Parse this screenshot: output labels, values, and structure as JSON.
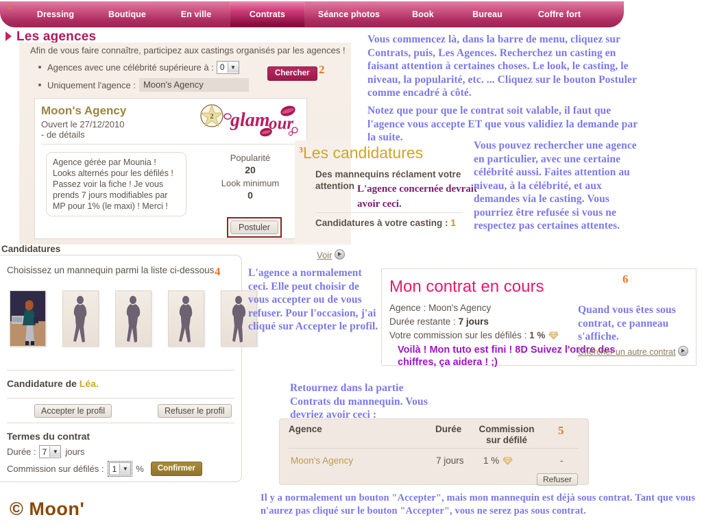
{
  "nav": {
    "marker": "1",
    "items": [
      {
        "label": "Dressing",
        "active": false
      },
      {
        "label": "Boutique",
        "active": false
      },
      {
        "label": "En ville",
        "active": false
      },
      {
        "label": "Contrats",
        "active": true
      },
      {
        "label": "Séance photos",
        "active": false
      },
      {
        "label": "Book",
        "active": false
      },
      {
        "label": "Bureau",
        "active": false
      },
      {
        "label": "Coffre fort",
        "active": false
      }
    ]
  },
  "page": {
    "title": "Les agences",
    "intro": "Afin de vous faire connaître, participez aux castings organisés par les agences !"
  },
  "filters": {
    "celebrity_label": "Agences avec une célébrité supérieure à :",
    "celebrity_value": "0",
    "agency_label": "Uniquement l'agence :",
    "agency_value": "Moon's Agency",
    "search_button": "Chercher",
    "marker": "2"
  },
  "agency_card": {
    "name": "Moon's Agency",
    "opened": "Ouvert le 27/12/2010",
    "details_link": "- de détails",
    "logo_text": "glamour",
    "star_level": "2",
    "description": "Agence gérée par Mounia ! Looks alternés pour les défilés ! Passez voir la fiche ! Je vous prends 7 jours modifiables par MP pour 1% (le maxi) ! Merci !",
    "popularity_label": "Popularité",
    "popularity_value": "20",
    "look_label": "Look minimum",
    "look_value": "0",
    "apply_button": "Postuler"
  },
  "candidatures_box": {
    "marker": "3",
    "title": "Les candidatures",
    "subtitle": "Des mannequins réclament votre attention",
    "count_label": "Candidatures à votre casting :",
    "count_value": "1",
    "see_link": "Voir"
  },
  "candidatures_panel": {
    "header": "Candidatures",
    "choose_text": "Choisissez un mannequin parmi la liste ci-dessous",
    "marker": "4",
    "thumbs": [
      {
        "name": "model-photo-thumb",
        "selected": true
      },
      {
        "name": "model-silhouette-thumb",
        "selected": false
      },
      {
        "name": "model-silhouette-thumb",
        "selected": false
      },
      {
        "name": "model-silhouette-thumb",
        "selected": false
      },
      {
        "name": "model-silhouette-thumb",
        "selected": false
      }
    ],
    "candidate_prefix": "Candidature de",
    "candidate_name": "Léa.",
    "accept_button": "Accepter le profil",
    "refuse_button": "Refuser le profil",
    "terms_title": "Termes du contrat",
    "duration_label": "Durée :",
    "duration_value": "7",
    "duration_unit": "jours",
    "commission_label": "Commission sur défilés :",
    "commission_value": "1",
    "commission_unit": "%",
    "confirm_button": "Confirmer"
  },
  "contract_panel": {
    "marker": "6",
    "title": "Mon contrat en cours",
    "agency_label": "Agence :",
    "agency_value": "Moon's Agency",
    "remaining_label": "Durée restante :",
    "remaining_value": "7 jours",
    "commission_label": "Votre commission sur les défilés :",
    "commission_value": "1 %",
    "tuto_done": "Voilà ! Mon tuto est fini ! 8D Suivez l'ordre des chiffres, ça aidera ! ;)",
    "search_other_link": "Chercher un autre contrat"
  },
  "contracts_table": {
    "marker": "5",
    "headers": [
      "Agence",
      "Durée",
      "Commission sur défilé",
      ""
    ],
    "rows": [
      {
        "agence": "Moon's Agency",
        "duree": "7 jours",
        "commission": "1 %",
        "last": "-"
      }
    ],
    "refuse_button": "Refuser"
  },
  "notes": {
    "top_right": "Vous commencez là, dans la barre de menu, cliquez sur Contrats, puis, Les Agences. Recherchez un casting en faisant attention à certaines choses. Le look, le casting, le niveau, la popularité, etc. ... Cliquez sur le bouton Postuler comme encadré à côté.",
    "mid_right": "Notez que pour que le contrat soit valable, il faut que l'agence vous accepte ET que vous validiez la demande par la suite.",
    "far_right": "Vous pouvez rechercher une agence en particulier, avec une certaine célébrité aussi. Faites attention au niveau, à la célébrité, et aux demandes via le casting. Vous pourriez être refusée si vous ne respectez pas certaines attentes.",
    "agency_concerned": "L'agence concernée devrait avoir ceci.",
    "agency_normally": "L'agence a normalement ceci. Elle peut choisir de vous accepter ou de vous refuser. Pour l'occasion, j'ai cliqué sur Accepter le profil.",
    "return_to": "Retournez dans la partie Contrats du mannequin. Vous devriez avoir ceci :",
    "under_contract": "Quand vous êtes sous contrat, ce panneau s'affiche.",
    "bottom": "Il y a normalement un bouton \"Accepter\", mais mon mannequin est déjà sous contrat. Tant que vous n'aurez pas cliqué sur le bouton \"Accepter\", vous ne serez pas sous contrat."
  },
  "footer": {
    "copyright": "© Moon'"
  },
  "colors": {
    "nav_pink": "#ac2b5f",
    "active_tab": "#8d0f42",
    "title_pink": "#b3185e",
    "marker_orange": "#e8762c",
    "note_blue": "#7b78e8",
    "gold": "#cfa42c",
    "magenta": "#e8196a",
    "purple": "#a013c8",
    "copyright_brown": "#8a4a07"
  }
}
